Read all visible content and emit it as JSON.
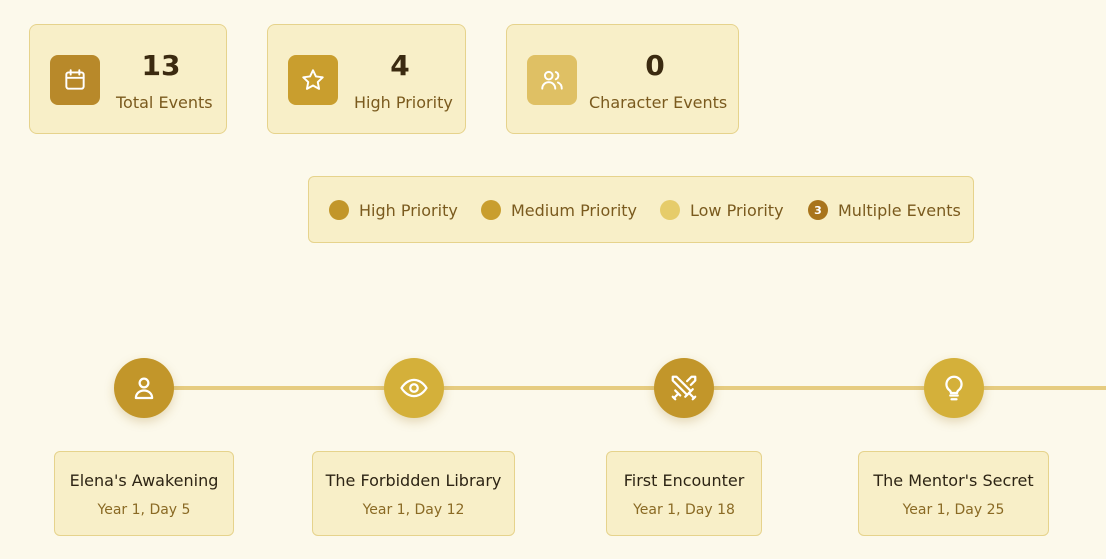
{
  "stats": [
    {
      "value": "13",
      "label": "Total Events",
      "icon": "calendar-icon",
      "color": "#b8892a"
    },
    {
      "value": "4",
      "label": "High Priority",
      "icon": "star-icon",
      "color": "#c99e2e"
    },
    {
      "value": "0",
      "label": "Character Events",
      "icon": "users-icon",
      "color": "#dfc064"
    }
  ],
  "legend": {
    "items": [
      {
        "label": "High Priority",
        "color": "#c2962a"
      },
      {
        "label": "Medium Priority",
        "color": "#c99e2e"
      },
      {
        "label": "Low Priority",
        "color": "#e6cc6a"
      },
      {
        "label": "Multiple Events",
        "count": "3",
        "color": "#a8741c"
      }
    ]
  },
  "events": [
    {
      "title": "Elena's Awakening",
      "date": "Year 1, Day 5",
      "icon": "user-icon",
      "color": "#c2962a"
    },
    {
      "title": "The Forbidden Library",
      "date": "Year 1, Day 12",
      "icon": "eye-icon",
      "color": "#d4b03a"
    },
    {
      "title": "First Encounter",
      "date": "Year 1, Day 18",
      "icon": "swords-icon",
      "color": "#c2962a"
    },
    {
      "title": "The Mentor's Secret",
      "date": "Year 1, Day 25",
      "icon": "lightbulb-icon",
      "color": "#d4b03a"
    }
  ]
}
